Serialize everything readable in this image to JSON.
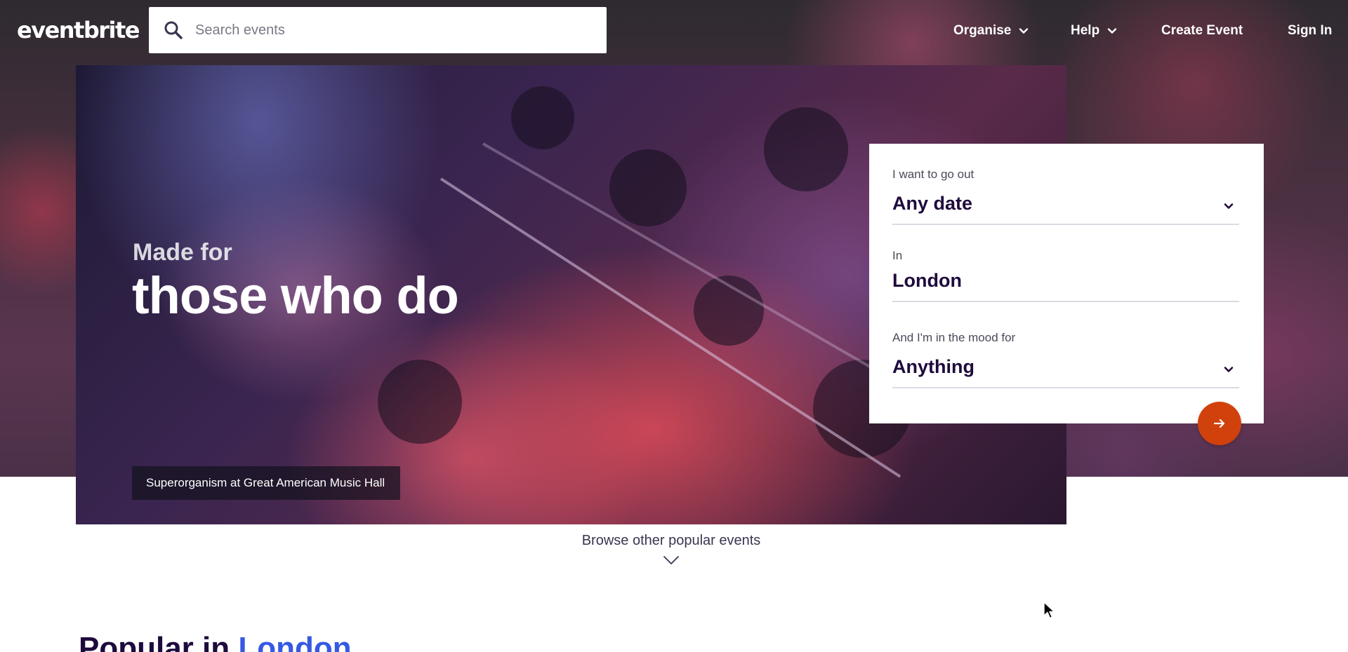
{
  "header": {
    "logo": "eventbrite",
    "search_placeholder": "Search events",
    "nav": {
      "organise": "Organise",
      "help": "Help",
      "create_event": "Create Event",
      "sign_in": "Sign In"
    }
  },
  "hero": {
    "made_for": "Made for",
    "headline": "those who do",
    "caption": "Superorganism at Great American Music Hall"
  },
  "search_card": {
    "date_label": "I want to go out",
    "date_value": "Any date",
    "location_label": "In",
    "location_value": "London",
    "mood_label": "And I'm in the mood for",
    "mood_value": "Anything"
  },
  "browse": {
    "label": "Browse other popular events"
  },
  "popular": {
    "prefix": "Popular in",
    "city": "London"
  },
  "colors": {
    "accent_orange": "#d1410c",
    "city_blue": "#3659e3",
    "heading_dark": "#1e0a3c"
  },
  "icons": [
    "search-icon",
    "chevron-down-icon",
    "arrow-right-icon",
    "cursor-icon"
  ]
}
